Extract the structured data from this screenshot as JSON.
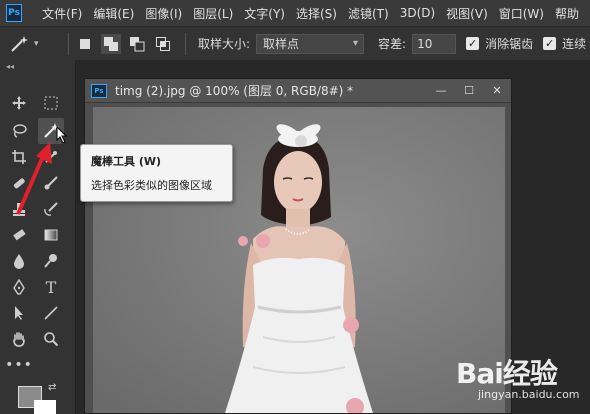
{
  "app": {
    "logo_text": "Ps"
  },
  "menu": [
    {
      "label": "文件(F)"
    },
    {
      "label": "编辑(E)"
    },
    {
      "label": "图像(I)"
    },
    {
      "label": "图层(L)"
    },
    {
      "label": "文字(Y)"
    },
    {
      "label": "选择(S)"
    },
    {
      "label": "滤镜(T)"
    },
    {
      "label": "3D(D)"
    },
    {
      "label": "视图(V)"
    },
    {
      "label": "窗口(W)"
    },
    {
      "label": "帮助"
    }
  ],
  "options": {
    "sample_size_label": "取样大小:",
    "sample_size_value": "取样点",
    "tolerance_label": "容差:",
    "tolerance_value": "10",
    "anti_alias_label": "消除锯齿",
    "anti_alias_checked": true,
    "contiguous_label": "连续",
    "contiguous_checked": true
  },
  "toolbar": {
    "active_tool": "magic-wand",
    "tools": [
      "move-icon",
      "marquee-icon",
      "lasso-icon",
      "magic-wand-icon",
      "crop-icon",
      "eyedropper-icon",
      "healing-brush-icon",
      "brush-icon",
      "clone-stamp-icon",
      "history-brush-icon",
      "eraser-icon",
      "gradient-icon",
      "blur-icon",
      "dodge-icon",
      "pen-icon",
      "type-icon",
      "path-selection-icon",
      "line-icon",
      "hand-icon",
      "zoom-icon",
      "more-icon"
    ],
    "foreground_color": "#8a8a8a",
    "background_color": "#ffffff"
  },
  "document": {
    "title": "timg (2).jpg @ 100% (图层 0, RGB/8#) *",
    "logo_text": "Ps"
  },
  "tooltip": {
    "title": "魔棒工具 (W)",
    "description": "选择色彩类似的图像区域"
  },
  "watermark": {
    "logo": "Bai经验",
    "url": "jingyan.baidu.com"
  },
  "colors": {
    "accent": "#31a8ff",
    "arrow": "#e0202a",
    "canvas_bg": "#7b7b7b"
  }
}
